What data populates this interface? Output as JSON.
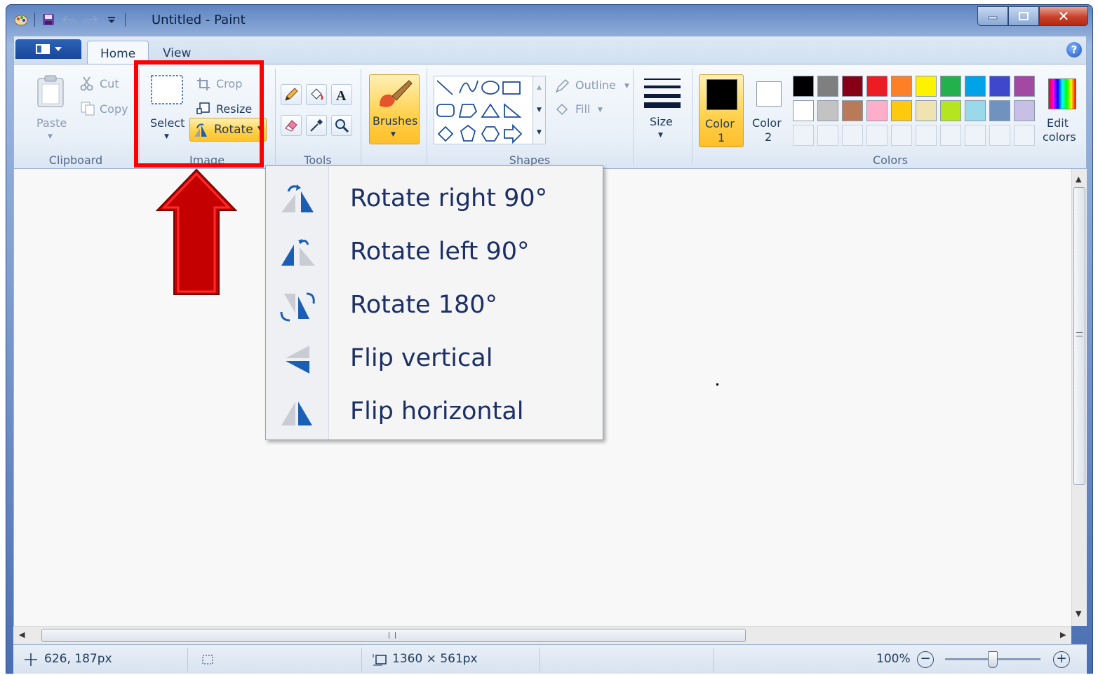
{
  "window": {
    "title": "Untitled - Paint",
    "minimize_icon": "minimize-icon",
    "maximize_icon": "maximize-icon",
    "close_symbol": "✕"
  },
  "tabs": [
    {
      "label": "Home",
      "active": true
    },
    {
      "label": "View",
      "active": false
    }
  ],
  "help_symbol": "?",
  "ribbon": {
    "clipboard": {
      "group_label": "Clipboard",
      "paste_label": "Paste",
      "cut_label": "Cut",
      "copy_label": "Copy"
    },
    "image": {
      "group_label": "Image",
      "select_label": "Select",
      "crop_label": "Crop",
      "resize_label": "Resize",
      "rotate_label": "Rotate"
    },
    "tools": {
      "group_label": "Tools"
    },
    "brushes": {
      "label": "Brushes"
    },
    "shapes": {
      "group_label": "Shapes",
      "outline_label": "Outline",
      "fill_label": "Fill"
    },
    "size": {
      "label": "Size"
    },
    "colors": {
      "group_label": "Colors",
      "color1_label": "Color",
      "color1_num": "1",
      "color2_label": "Color",
      "color2_num": "2",
      "edit_label": "Edit",
      "edit_label2": "colors",
      "row1": [
        "#000000",
        "#7f7f7f",
        "#880015",
        "#ed1c24",
        "#ff7f27",
        "#fff200",
        "#22b14c",
        "#00a2e8",
        "#3f48cc",
        "#a349a4"
      ],
      "row2": [
        "#ffffff",
        "#c3c3c3",
        "#b97a57",
        "#ffaec9",
        "#ffc90e",
        "#efe4b0",
        "#b5e61d",
        "#99d9ea",
        "#7092be",
        "#c8bfe7"
      ],
      "color1_value": "#000000",
      "color2_value": "#ffffff"
    }
  },
  "rotate_menu": [
    {
      "label": "Rotate right 90°",
      "icon": "rotate-right-icon"
    },
    {
      "label": "Rotate left 90°",
      "icon": "rotate-left-icon"
    },
    {
      "label": "Rotate 180°",
      "icon": "rotate-180-icon"
    },
    {
      "label": "Flip vertical",
      "icon": "flip-vertical-icon"
    },
    {
      "label": "Flip horizontal",
      "icon": "flip-horizontal-icon"
    }
  ],
  "status": {
    "cursor_pos": "626, 187px",
    "canvas_size": "1360 × 561px",
    "zoom": "100%",
    "zoom_level": 1.0
  },
  "annotation_colors": {
    "highlight": "#ff0000",
    "arrow": "#c40000"
  }
}
